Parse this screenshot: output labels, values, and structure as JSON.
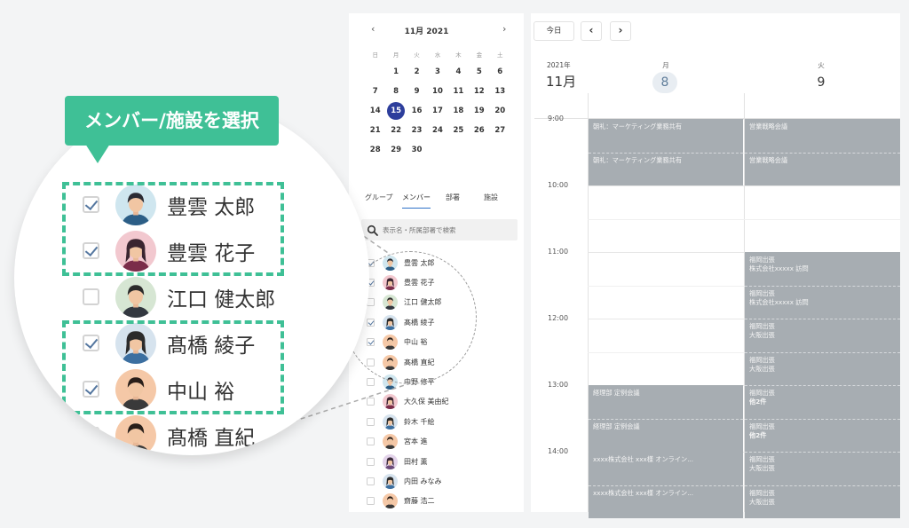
{
  "mini_calendar": {
    "prev_icon": "chevron-left-icon",
    "next_icon": "chevron-right-icon",
    "month_label": "11月 2021",
    "weekdays": [
      "日",
      "月",
      "火",
      "水",
      "木",
      "金",
      "土"
    ],
    "weeks": [
      [
        "",
        "1",
        "2",
        "3",
        "4",
        "5",
        "6"
      ],
      [
        "7",
        "8",
        "9",
        "10",
        "11",
        "12",
        "13"
      ],
      [
        "14",
        "15",
        "16",
        "17",
        "18",
        "19",
        "20"
      ],
      [
        "21",
        "22",
        "23",
        "24",
        "25",
        "26",
        "27"
      ],
      [
        "28",
        "29",
        "30",
        "",
        "",
        "",
        ""
      ]
    ],
    "today": "15",
    "today_color": "#2d3e9c"
  },
  "tabs": [
    "グループ",
    "メンバー",
    "部署",
    "施設"
  ],
  "active_tab": "メンバー",
  "search": {
    "placeholder": "表示名・所属部署で検索",
    "icon": "search-icon"
  },
  "members": [
    {
      "name": "豊雲 太郎",
      "checked": true,
      "avatar": "man-blue"
    },
    {
      "name": "豊雲 花子",
      "checked": true,
      "avatar": "woman-pink"
    },
    {
      "name": "江口 健太郎",
      "checked": false,
      "avatar": "man-green"
    },
    {
      "name": "髙橋 綾子",
      "checked": true,
      "avatar": "woman-blue"
    },
    {
      "name": "中山 裕",
      "checked": true,
      "avatar": "man-orange"
    },
    {
      "name": "髙橋 直紀",
      "checked": false,
      "avatar": "man-orange"
    },
    {
      "name": "中野 修平",
      "checked": false,
      "avatar": "man-blue"
    },
    {
      "name": "大久保 美由紀",
      "checked": false,
      "avatar": "woman-pink"
    },
    {
      "name": "鈴木 千絵",
      "checked": false,
      "avatar": "woman-blue"
    },
    {
      "name": "宮本 進",
      "checked": false,
      "avatar": "man-orange"
    },
    {
      "name": "田村 薫",
      "checked": false,
      "avatar": "woman-purple"
    },
    {
      "name": "内田 みなみ",
      "checked": false,
      "avatar": "woman-blue"
    },
    {
      "name": "齋藤 浩二",
      "checked": false,
      "avatar": "man-orange"
    }
  ],
  "toolbar": {
    "today_label": "今日",
    "prev_icon": "chevron-left-icon",
    "next_icon": "chevron-right-icon"
  },
  "calendar": {
    "year_label": "2021年",
    "month_label": "11月",
    "days": [
      {
        "dow": "月",
        "num": "8",
        "highlight": true
      },
      {
        "dow": "火",
        "num": "9",
        "highlight": false
      }
    ],
    "hours": [
      "9:00",
      "10:00",
      "11:00",
      "12:00",
      "13:00",
      "14:00"
    ],
    "events_mon": [
      {
        "title": "朝礼：マーケティング業務共有",
        "sub": ""
      },
      {
        "title": "朝礼：マーケティング業務共有",
        "sub": ""
      },
      {
        "title": "経理部 定例会議",
        "sub": ""
      },
      {
        "title": "経理部 定例会議",
        "sub": ""
      },
      {
        "title": "xxxx株式会社 xxx様 オンライン...",
        "sub": ""
      },
      {
        "title": "xxxx株式会社 xxx様 オンライン...",
        "sub": ""
      }
    ],
    "events_tue": [
      {
        "title": "営業戦略会議",
        "sub": ""
      },
      {
        "title": "営業戦略会議",
        "sub": ""
      },
      {
        "title": "福岡出張",
        "sub": "株式会社xxxxx 訪問"
      },
      {
        "title": "福岡出張",
        "sub": "株式会社xxxxx 訪問"
      },
      {
        "title": "福岡出張",
        "sub": "大阪出張"
      },
      {
        "title": "福岡出張",
        "sub": "大阪出張"
      },
      {
        "title": "福岡出張",
        "sub": "他2件"
      },
      {
        "title": "福岡出張",
        "sub": "他2件"
      },
      {
        "title": "福岡出張",
        "sub": "大阪出張"
      },
      {
        "title": "福岡出張",
        "sub": "大阪出張"
      }
    ],
    "event_color": "#a7adb2"
  },
  "callout": {
    "label": "メンバー/施設を選択",
    "color": "#3fc096",
    "zoom_members": [
      {
        "name": "豊雲 太郎",
        "checked": true,
        "avatar": "man-blue"
      },
      {
        "name": "豊雲 花子",
        "checked": true,
        "avatar": "woman-pink"
      },
      {
        "name": "江口 健太郎",
        "checked": false,
        "avatar": "man-green"
      },
      {
        "name": "髙橋 綾子",
        "checked": true,
        "avatar": "woman-blue"
      },
      {
        "name": "中山 裕",
        "checked": true,
        "avatar": "man-orange"
      },
      {
        "name": "髙橋 直紀",
        "checked": false,
        "avatar": "man-orange"
      }
    ]
  }
}
